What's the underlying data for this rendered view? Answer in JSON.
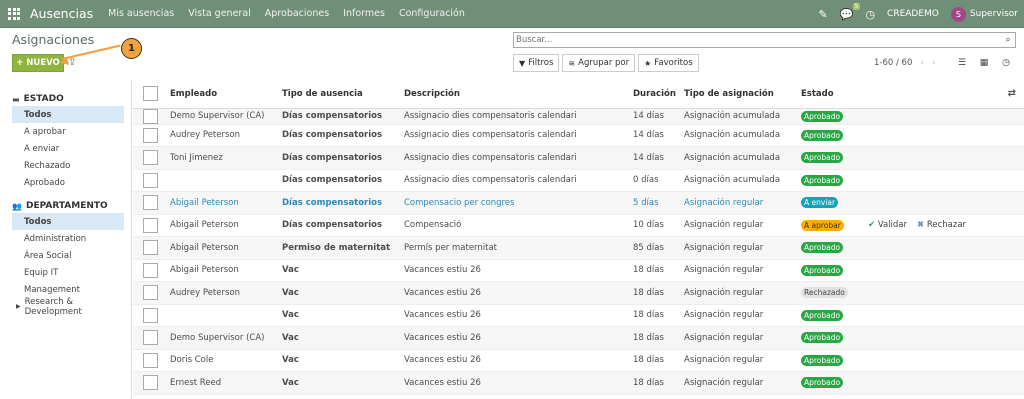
{
  "navbar": {
    "app_name": "Ausencias",
    "menu": [
      "Mis ausencias",
      "Vista general",
      "Aprobaciones",
      "Informes",
      "Configuración"
    ],
    "chat_badge": "5",
    "company": "CREADEMO",
    "avatar_letter": "S",
    "user": "Supervisor"
  },
  "page": {
    "title": "Asignaciones",
    "new_button": "NUEVO",
    "callout": "1",
    "search_placeholder": "Buscar...",
    "filters_label": "Filtros",
    "group_label": "Agrupar por",
    "favorites_label": "Favoritos",
    "pager": "1-60 / 60"
  },
  "sidebar": {
    "estado_title": "ESTADO",
    "estado_items": [
      "Todos",
      "A aprobar",
      "A enviar",
      "Rechazado",
      "Aprobado"
    ],
    "departamento_title": "DEPARTAMENTO",
    "departamento_items": [
      "Todos",
      "Administration",
      "Área Social",
      "Equip IT",
      "Management",
      "Research & Development"
    ]
  },
  "table": {
    "headers": [
      "Empleado",
      "Tipo de ausencia",
      "Descripción",
      "Duración",
      "Tipo de asignación",
      "Estado"
    ],
    "rows": [
      {
        "empleado": "Demo Supervisor (CA)",
        "tipo": "Días compensatorios",
        "desc": "Assignacio dies compensatoris calendari",
        "dur": "14 días",
        "asig": "Asignación acumulada",
        "estado": "Aprobado"
      },
      {
        "empleado": "Audrey Peterson",
        "tipo": "Días compensatorios",
        "desc": "Assignacio dies compensatoris calendari",
        "dur": "14 días",
        "asig": "Asignación acumulada",
        "estado": "Aprobado"
      },
      {
        "empleado": "Toni Jimenez",
        "tipo": "Días compensatorios",
        "desc": "Assignacio dies compensatoris calendari",
        "dur": "14 días",
        "asig": "Asignación acumulada",
        "estado": "Aprobado"
      },
      {
        "empleado": "",
        "tipo": "Días compensatorios",
        "desc": "Assignacio dies compensatoris calendari",
        "dur": "0 días",
        "asig": "Asignación acumulada",
        "estado": "Aprobado"
      },
      {
        "empleado": "Abigail Peterson",
        "tipo": "Días compensatorios",
        "desc": "Compensacio per congres",
        "dur": "5 días",
        "asig": "Asignación regular",
        "estado": "A enviar"
      },
      {
        "empleado": "Abigail Peterson",
        "tipo": "Días compensatorios",
        "desc": "Compensació",
        "dur": "10 días",
        "asig": "Asignación regular",
        "estado": "A aprobar"
      },
      {
        "empleado": "Abigail Peterson",
        "tipo": "Permiso de maternitat",
        "desc": "Permís per maternitat",
        "dur": "85 días",
        "asig": "Asignación regular",
        "estado": "Aprobado"
      },
      {
        "empleado": "Abigail Peterson",
        "tipo": "Vac",
        "desc": "Vacances estiu 26",
        "dur": "18 días",
        "asig": "Asignación regular",
        "estado": "Aprobado"
      },
      {
        "empleado": "Audrey Peterson",
        "tipo": "Vac",
        "desc": "Vacances estiu 26",
        "dur": "18 días",
        "asig": "Asignación regular",
        "estado": "Rechazado"
      },
      {
        "empleado": "",
        "tipo": "Vac",
        "desc": "Vacances estiu 26",
        "dur": "18 días",
        "asig": "Asignación regular",
        "estado": "Aprobado"
      },
      {
        "empleado": "Demo Supervisor (CA)",
        "tipo": "Vac",
        "desc": "Vacances estiu 26",
        "dur": "18 días",
        "asig": "Asignación regular",
        "estado": "Aprobado"
      },
      {
        "empleado": "Doris Cole",
        "tipo": "Vac",
        "desc": "Vacances estiu 26",
        "dur": "18 días",
        "asig": "Asignación regular",
        "estado": "Aprobado"
      },
      {
        "empleado": "Ernest Reed",
        "tipo": "Vac",
        "desc": "Vacances estiu 26",
        "dur": "18 días",
        "asig": "Asignación regular",
        "estado": "Aprobado"
      }
    ],
    "validate_label": "Validar",
    "reject_label": "Rechazar"
  }
}
